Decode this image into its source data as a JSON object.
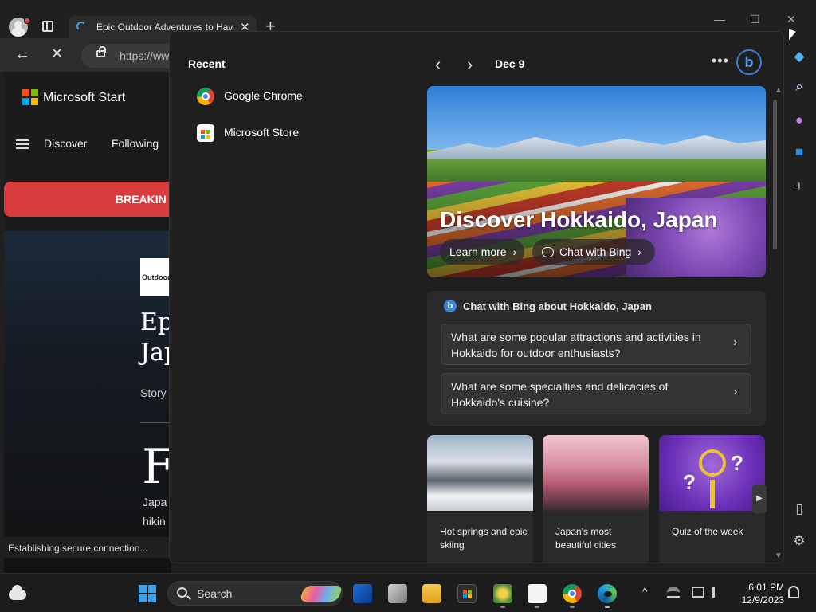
{
  "browser": {
    "tab_title": "Epic Outdoor Adventures to Have in Japan",
    "tab_close": "✕",
    "new_tab": "+",
    "url_prefix": "https://ww",
    "back": "←",
    "stop": "✕",
    "status_text": "Establishing secure connection..."
  },
  "page": {
    "brand": "Microsoft Start",
    "nav": [
      "Discover",
      "Following"
    ],
    "breaking_label": "BREAKIN",
    "outlet_logo_text": "Outdoor",
    "article_title_lines": [
      "Epi",
      "Jap"
    ],
    "story_label": "Story",
    "dropcap": "F",
    "body_lines": [
      "Japa",
      "hikin"
    ]
  },
  "window_controls": {
    "minimize": "—",
    "maximize": "☐",
    "close": "✕"
  },
  "widgets": {
    "recent_title": "Recent",
    "recent_items": [
      {
        "label": "Google Chrome",
        "icon": "chrome-icon"
      },
      {
        "label": "Microsoft Store",
        "icon": "store-icon"
      }
    ],
    "header": {
      "prev": "‹",
      "next": "›",
      "date": "Dec 9",
      "more": "•••",
      "bing": "b"
    },
    "hero": {
      "title": "Discover Hokkaido, Japan",
      "learn_more": "Learn more",
      "chat_with_bing": "Chat with Bing"
    },
    "bing_card": {
      "title": "Chat with Bing about Hokkaido, Japan",
      "questions": [
        "What are some popular attractions and activities in Hokkaido for outdoor enthusiasts?",
        "What are some specialties and delicacies of Hokkaido's cuisine?"
      ]
    },
    "thumbs": [
      {
        "label": "Hot springs and epic skiing"
      },
      {
        "label": "Japan's most beautiful cities"
      },
      {
        "label": "Quiz of the week"
      }
    ],
    "carousel_next": "▶"
  },
  "taskbar": {
    "search_placeholder": "Search",
    "time": "6:01 PM",
    "date": "12/9/2023",
    "tray_chevron": "^"
  },
  "colors": {
    "accent_blue": "#3a86e0",
    "breaking_red": "#d83b3b",
    "panel_bg": "#1f1f1f",
    "card_bg": "#2a2a2a"
  }
}
